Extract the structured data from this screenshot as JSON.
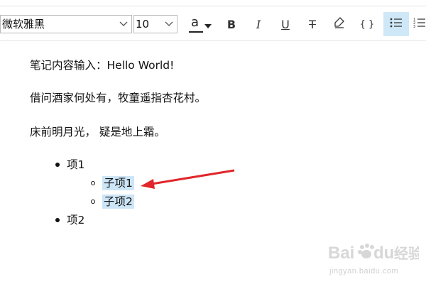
{
  "toolbar": {
    "font_family_value": "微软雅黑",
    "font_size_value": "10",
    "font_color_label": "a",
    "bold_label": "B",
    "italic_label": "I",
    "underline_label": "U",
    "strikethrough_label": "T",
    "code_label": "{ }",
    "accent_color": "#cfe8f7",
    "font_color_bar": "#222222"
  },
  "editor": {
    "paragraphs": [
      "笔记内容输入：Hello World!",
      "借问酒家何处有，牧童遥指杏花村。",
      "床前明月光， 疑是地上霜。"
    ],
    "list": [
      {
        "label": "项1",
        "children": [
          "子项1",
          "子项2"
        ]
      },
      {
        "label": "项2",
        "children": []
      }
    ],
    "highlight_color": "#cde6f7",
    "arrow_color": "#e0262b"
  },
  "watermark": {
    "brand_text": "Baidu",
    "brand_cn": "经验",
    "url": "jingyan.baidu.com"
  }
}
